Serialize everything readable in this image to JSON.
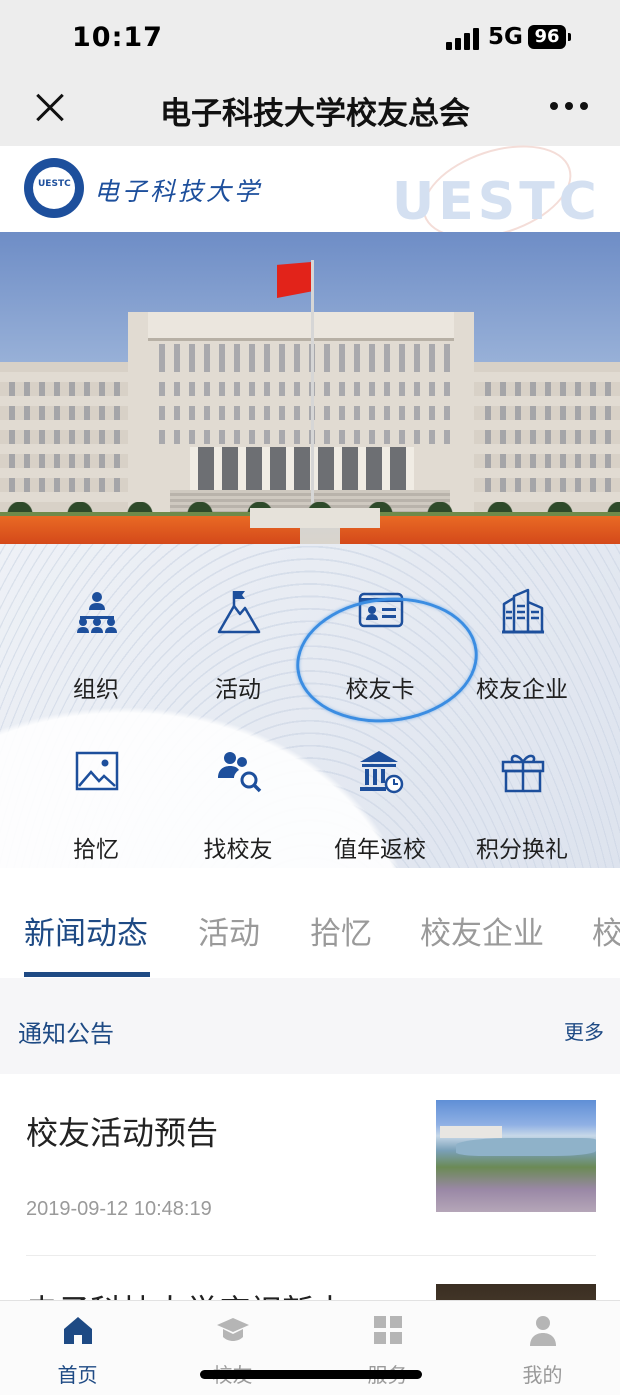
{
  "status_bar": {
    "time": "10:17",
    "network": "5G",
    "battery": "96"
  },
  "navbar": {
    "title": "电子科技大学校友总会"
  },
  "school_header": {
    "logo_text": "电子科技大学",
    "seal_text": "UESTC",
    "watermark": "UESTC"
  },
  "menu": {
    "items": [
      {
        "label": "组织",
        "icon": "org-chart-icon"
      },
      {
        "label": "活动",
        "icon": "mountain-flag-icon"
      },
      {
        "label": "校友卡",
        "icon": "id-card-icon"
      },
      {
        "label": "校友企业",
        "icon": "building-icon"
      },
      {
        "label": "拾忆",
        "icon": "picture-icon"
      },
      {
        "label": "找校友",
        "icon": "people-search-icon"
      },
      {
        "label": "值年返校",
        "icon": "school-clock-icon"
      },
      {
        "label": "积分换礼",
        "icon": "gift-icon"
      }
    ]
  },
  "tabs": [
    {
      "label": "新闻动态",
      "active": true
    },
    {
      "label": "活动"
    },
    {
      "label": "拾忆"
    },
    {
      "label": "校友企业"
    },
    {
      "label": "校"
    }
  ],
  "notice": {
    "title": "通知公告",
    "more": "更多"
  },
  "news": [
    {
      "title": "校友活动预告",
      "date": "2019-09-12 10:48:19"
    },
    {
      "title": "电子科技大学庆祝新中"
    }
  ],
  "bottom_nav": [
    {
      "label": "首页",
      "icon": "home-icon",
      "active": true
    },
    {
      "label": "校友",
      "icon": "graduation-cap-icon"
    },
    {
      "label": "服务",
      "icon": "grid-icon"
    },
    {
      "label": "我的",
      "icon": "user-icon"
    }
  ],
  "colors": {
    "accent": "#1e4a84",
    "icon_blue": "#1d4f9c",
    "annotation_circle": "#3b8de2"
  }
}
